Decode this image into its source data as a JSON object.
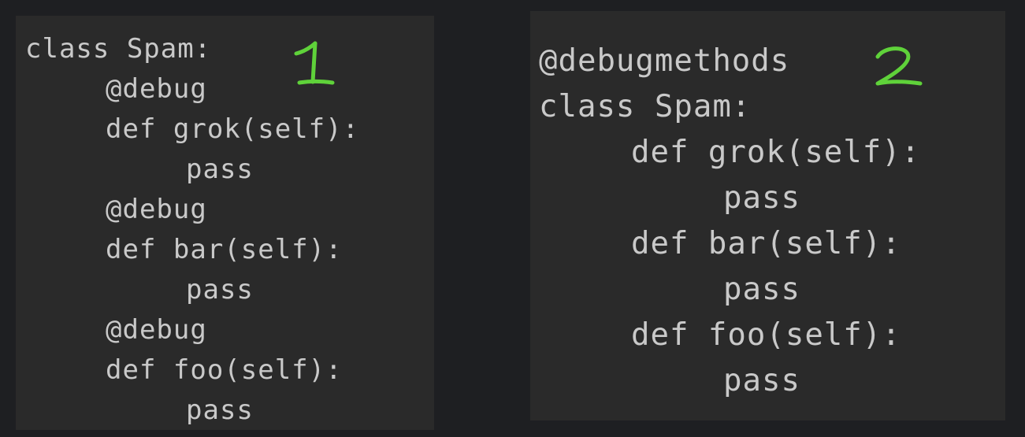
{
  "panels": [
    {
      "marker": "1",
      "lines": [
        "class Spam:",
        "@debug",
        "def grok(self):",
        "pass",
        "@debug",
        "def bar(self):",
        "pass",
        "@debug",
        "def foo(self):",
        "pass"
      ]
    },
    {
      "marker": "2",
      "lines": [
        "@debugmethods",
        "class Spam:",
        "def grok(self):",
        "pass",
        "def bar(self):",
        "pass",
        "def foo(self):",
        "pass"
      ]
    }
  ],
  "colors": {
    "background": "#1e1f22",
    "panel": "#2a2a2a",
    "code_text": "#c9c9c9",
    "marker": "#5fd23a"
  }
}
